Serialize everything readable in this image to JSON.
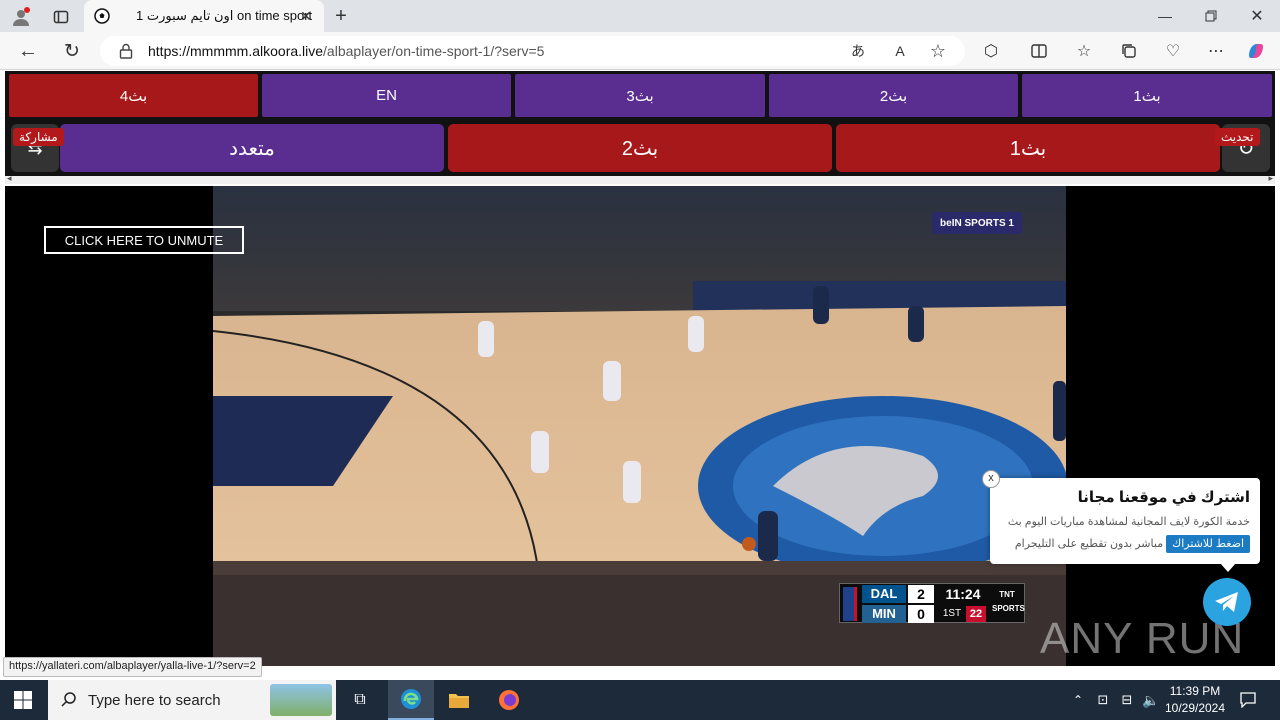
{
  "browser": {
    "tab_title": "اون تايم سبورت 1 on time sport",
    "url_host": "https://mmmmm.alkoora.live",
    "url_path": "/albaplayer/on-time-sport-1/?serv=5"
  },
  "nav_top": [
    {
      "label": "بث4",
      "color": "#a6181a"
    },
    {
      "label": "EN",
      "color": "#5a2d91"
    },
    {
      "label": "بث3",
      "color": "#5a2d91"
    },
    {
      "label": "بث2",
      "color": "#5a2d91"
    },
    {
      "label": "بث1",
      "color": "#5a2d91"
    }
  ],
  "nav_main": {
    "share_label": "مشاركة",
    "refresh_label": "تحديث",
    "multi_label": "متعدد",
    "stream2_label": "بث2",
    "stream1_label": "بث1"
  },
  "video": {
    "unmute_label": "CLICK HERE TO UNMUTE",
    "channel_logo": "beIN SPORTS 1",
    "scoreboard": {
      "team1": "DAL",
      "score1": "2",
      "team2": "MIN",
      "score2": "0",
      "clock": "11:24",
      "period": "1ST",
      "shot_clock": "22",
      "network": "TNT SPORTS"
    }
  },
  "popup": {
    "close": "x",
    "title": "اشترك في موقعنا مجانا",
    "desc1": "خدمة الكورة لايف المجانية لمشاهدة مباريات اليوم بث",
    "desc2": "مباشر بدون تقطيع على التليجرام",
    "button": "اضغط للاشتراك"
  },
  "watermark": "ANY RUN",
  "status_url": "https://yallateri.com/albaplayer/yalla-live-1/?serv=2",
  "taskbar": {
    "search_placeholder": "Type here to search",
    "time": "11:39 PM",
    "date": "10/29/2024"
  }
}
